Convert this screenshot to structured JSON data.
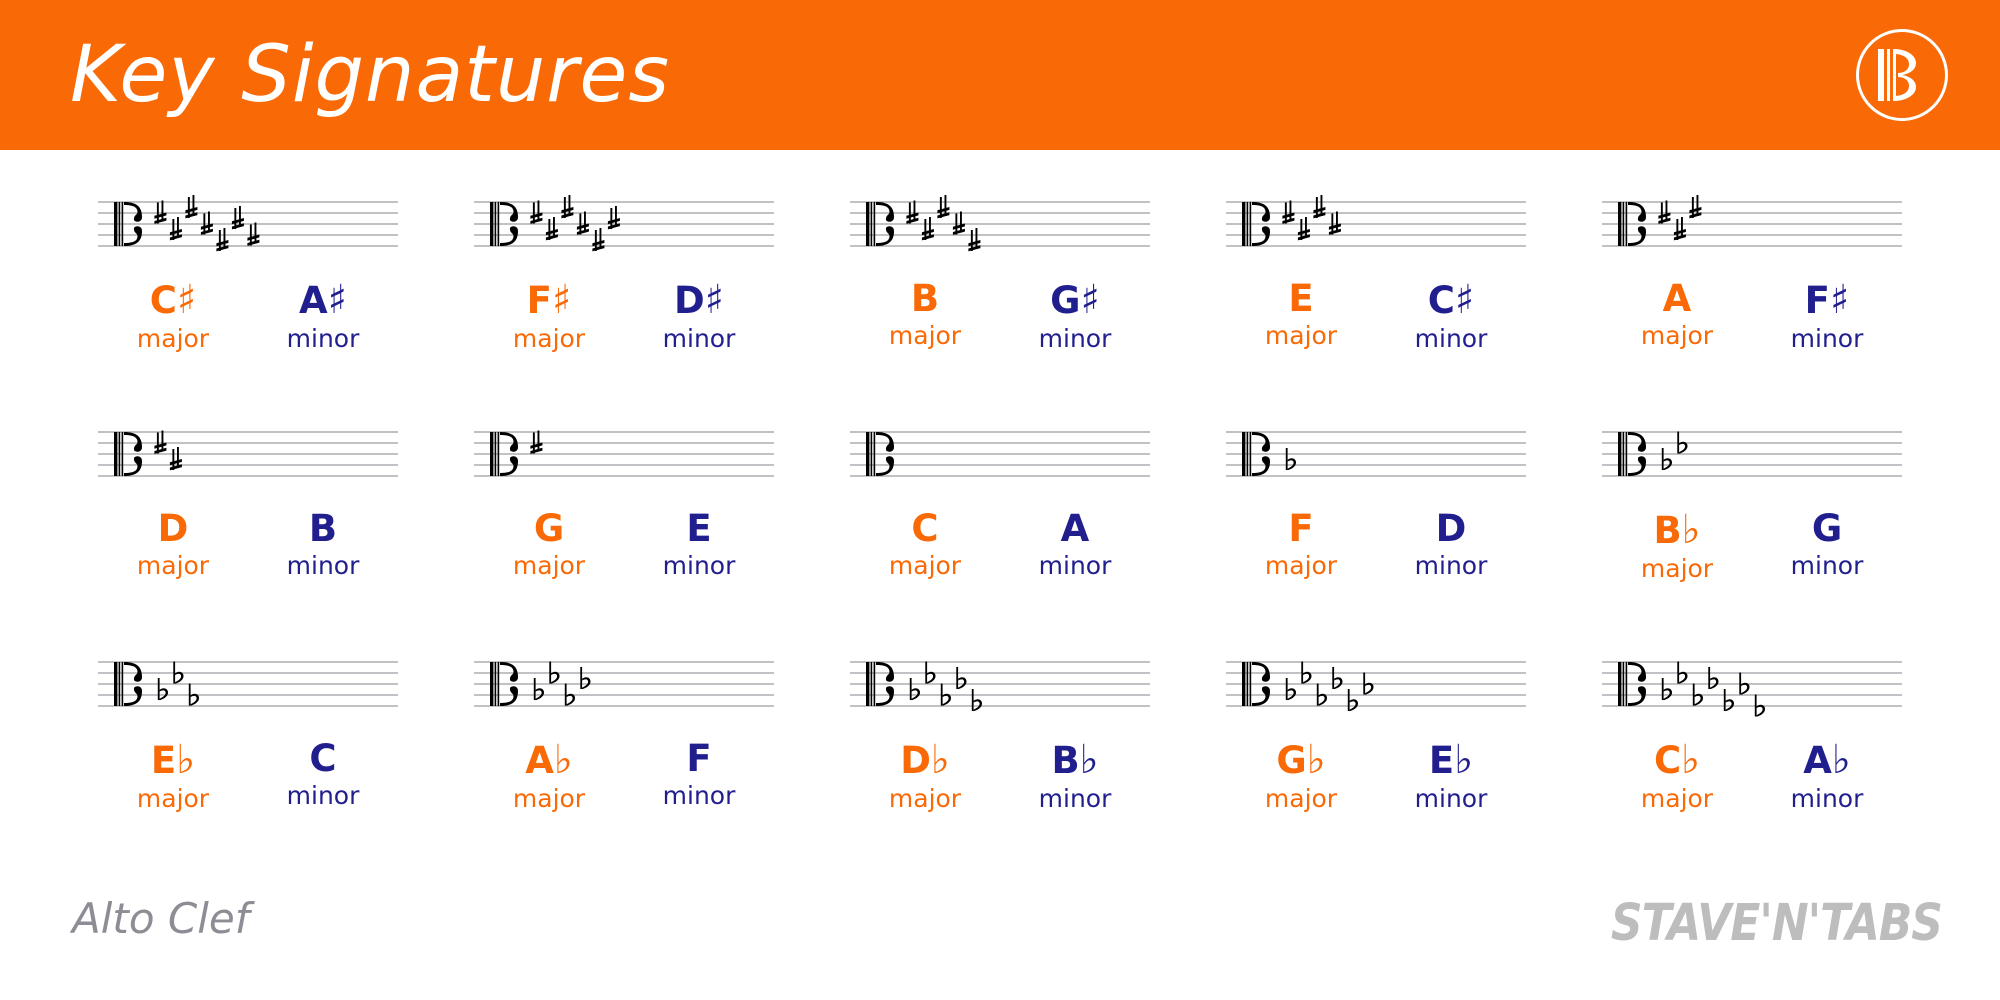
{
  "header": {
    "title": "Key Signatures",
    "logo_icon": "alto-clef-circle-icon",
    "background_color": "#f96a07",
    "title_color": "#ffffff"
  },
  "colors": {
    "orange": "#f96a07",
    "navy": "#211f8e",
    "stave_line": "#9a9aa0",
    "footer_gray": "#8d8d95",
    "watermark_gray": "#bdbdbd"
  },
  "footer": {
    "clef_caption": "Alto Clef",
    "watermark": "STAVE'N'TABS"
  },
  "common": {
    "major_label": "major",
    "minor_label": "minor",
    "clef_icon": "alto-clef-icon",
    "sharp_glyph": "♯",
    "flat_glyph": "♭"
  },
  "chart_data": {
    "type": "table",
    "title": "Key Signatures",
    "subtitle": "Alto Clef",
    "description": "Grid of 15 key signatures shown on an alto-clef stave, each labelled with its major key (orange) and relative minor key (navy).",
    "columns": 5,
    "rows": 3,
    "cells": [
      {
        "row": 1,
        "col": 1,
        "accidental_type": "sharp",
        "accidental_count": 7,
        "major": "C♯",
        "major_letter": "C",
        "major_accidental": "♯",
        "minor": "A♯",
        "minor_letter": "A",
        "minor_accidental": "♯"
      },
      {
        "row": 1,
        "col": 2,
        "accidental_type": "sharp",
        "accidental_count": 6,
        "major": "F♯",
        "major_letter": "F",
        "major_accidental": "♯",
        "minor": "D♯",
        "minor_letter": "D",
        "minor_accidental": "♯"
      },
      {
        "row": 1,
        "col": 3,
        "accidental_type": "sharp",
        "accidental_count": 5,
        "major": "B",
        "major_letter": "B",
        "major_accidental": "",
        "minor": "G♯",
        "minor_letter": "G",
        "minor_accidental": "♯"
      },
      {
        "row": 1,
        "col": 4,
        "accidental_type": "sharp",
        "accidental_count": 4,
        "major": "E",
        "major_letter": "E",
        "major_accidental": "",
        "minor": "C♯",
        "minor_letter": "C",
        "minor_accidental": "♯"
      },
      {
        "row": 1,
        "col": 5,
        "accidental_type": "sharp",
        "accidental_count": 3,
        "major": "A",
        "major_letter": "A",
        "major_accidental": "",
        "minor": "F♯",
        "minor_letter": "F",
        "minor_accidental": "♯"
      },
      {
        "row": 2,
        "col": 1,
        "accidental_type": "sharp",
        "accidental_count": 2,
        "major": "D",
        "major_letter": "D",
        "major_accidental": "",
        "minor": "B",
        "minor_letter": "B",
        "minor_accidental": ""
      },
      {
        "row": 2,
        "col": 2,
        "accidental_type": "sharp",
        "accidental_count": 1,
        "major": "G",
        "major_letter": "G",
        "major_accidental": "",
        "minor": "E",
        "minor_letter": "E",
        "minor_accidental": ""
      },
      {
        "row": 2,
        "col": 3,
        "accidental_type": "none",
        "accidental_count": 0,
        "major": "C",
        "major_letter": "C",
        "major_accidental": "",
        "minor": "A",
        "minor_letter": "A",
        "minor_accidental": ""
      },
      {
        "row": 2,
        "col": 4,
        "accidental_type": "flat",
        "accidental_count": 1,
        "major": "F",
        "major_letter": "F",
        "major_accidental": "",
        "minor": "D",
        "minor_letter": "D",
        "minor_accidental": ""
      },
      {
        "row": 2,
        "col": 5,
        "accidental_type": "flat",
        "accidental_count": 2,
        "major": "B♭",
        "major_letter": "B",
        "major_accidental": "♭",
        "minor": "G",
        "minor_letter": "G",
        "minor_accidental": ""
      },
      {
        "row": 3,
        "col": 1,
        "accidental_type": "flat",
        "accidental_count": 3,
        "major": "E♭",
        "major_letter": "E",
        "major_accidental": "♭",
        "minor": "C",
        "minor_letter": "C",
        "minor_accidental": ""
      },
      {
        "row": 3,
        "col": 2,
        "accidental_type": "flat",
        "accidental_count": 4,
        "major": "A♭",
        "major_letter": "A",
        "major_accidental": "♭",
        "minor": "F",
        "minor_letter": "F",
        "minor_accidental": ""
      },
      {
        "row": 3,
        "col": 3,
        "accidental_type": "flat",
        "accidental_count": 5,
        "major": "D♭",
        "major_letter": "D",
        "major_accidental": "♭",
        "minor": "B♭",
        "minor_letter": "B",
        "minor_accidental": "♭"
      },
      {
        "row": 3,
        "col": 4,
        "accidental_type": "flat",
        "accidental_count": 6,
        "major": "G♭",
        "major_letter": "G",
        "major_accidental": "♭",
        "minor": "E♭",
        "minor_letter": "E",
        "minor_accidental": "♭"
      },
      {
        "row": 3,
        "col": 5,
        "accidental_type": "flat",
        "accidental_count": 7,
        "major": "C♭",
        "major_letter": "C",
        "major_accidental": "♭",
        "minor": "A♭",
        "minor_letter": "A",
        "minor_accidental": "♭"
      }
    ]
  }
}
